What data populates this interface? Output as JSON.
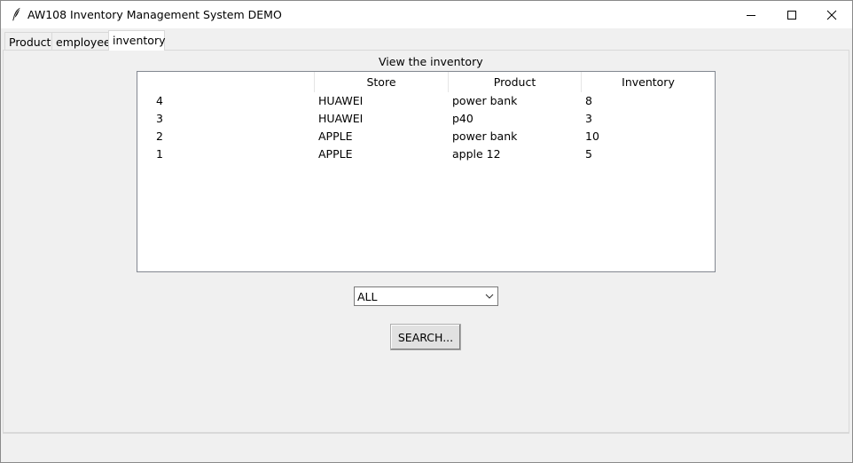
{
  "window": {
    "title": "AW108 Inventory Management System DEMO",
    "app_icon": "feather-icon",
    "controls": [
      "minimize-icon",
      "maximize-icon",
      "close-icon"
    ]
  },
  "tabs": [
    {
      "label": "Product",
      "selected": false
    },
    {
      "label": "employee",
      "selected": false
    },
    {
      "label": "inventory",
      "selected": true
    }
  ],
  "inventory_view": {
    "label": "View the inventory",
    "columns": [
      "",
      "Store",
      "Product",
      "Inventory"
    ],
    "rows": [
      {
        "id": "4",
        "store": "HUAWEI",
        "product": "power bank",
        "inventory": "8"
      },
      {
        "id": "3",
        "store": "HUAWEI",
        "product": "p40",
        "inventory": "3"
      },
      {
        "id": "2",
        "store": "APPLE",
        "product": "power bank",
        "inventory": "10"
      },
      {
        "id": "1",
        "store": "APPLE",
        "product": "apple 12",
        "inventory": "5"
      }
    ]
  },
  "filter": {
    "selected": "ALL",
    "arrow_icon": "chevron-down-icon"
  },
  "search_button": {
    "label": "SEARCH..."
  }
}
